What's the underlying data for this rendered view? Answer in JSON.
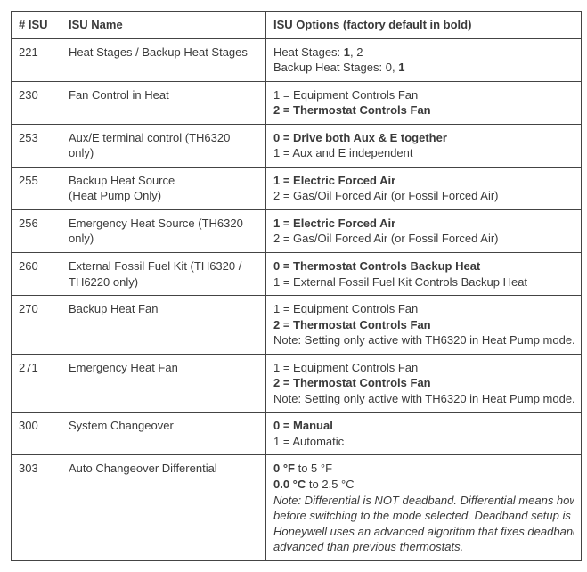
{
  "headers": {
    "isu": "# ISU",
    "name": "ISU Name",
    "options": "ISU Options (factory default in bold)"
  },
  "rows": [
    {
      "isu": "221",
      "name_lines": [
        {
          "text": "Heat Stages / Backup Heat Stages"
        }
      ],
      "option_lines": [
        {
          "segments": [
            {
              "t": "Heat Stages: "
            },
            {
              "t": "1",
              "b": true
            },
            {
              "t": ", 2"
            }
          ]
        },
        {
          "segments": [
            {
              "t": "Backup Heat Stages: 0, "
            },
            {
              "t": "1",
              "b": true
            }
          ]
        }
      ]
    },
    {
      "isu": "230",
      "name_lines": [
        {
          "text": "Fan Control in Heat"
        }
      ],
      "option_lines": [
        {
          "segments": [
            {
              "t": "1 = Equipment Controls Fan"
            }
          ]
        },
        {
          "segments": [
            {
              "t": "2 = Thermostat Controls Fan",
              "b": true
            }
          ]
        }
      ]
    },
    {
      "isu": "253",
      "name_lines": [
        {
          "text": "Aux/E terminal control (TH6320 only)"
        }
      ],
      "option_lines": [
        {
          "segments": [
            {
              "t": "0 = Drive both Aux & E together",
              "b": true
            }
          ]
        },
        {
          "segments": [
            {
              "t": "1 = Aux and E independent"
            }
          ]
        }
      ]
    },
    {
      "isu": "255",
      "name_lines": [
        {
          "text": "Backup Heat Source"
        },
        {
          "text": "(Heat Pump Only)"
        }
      ],
      "option_lines": [
        {
          "segments": [
            {
              "t": "1 = Electric Forced Air",
              "b": true
            }
          ]
        },
        {
          "segments": [
            {
              "t": "2 = Gas/Oil Forced Air (or Fossil Forced Air)"
            }
          ]
        }
      ]
    },
    {
      "isu": "256",
      "name_lines": [
        {
          "text": "Emergency Heat Source (TH6320 only)"
        }
      ],
      "option_lines": [
        {
          "segments": [
            {
              "t": "1 = Electric Forced Air",
              "b": true
            }
          ]
        },
        {
          "segments": [
            {
              "t": "2 = Gas/Oil Forced Air (or Fossil Forced Air)"
            }
          ]
        }
      ]
    },
    {
      "isu": "260",
      "name_lines": [
        {
          "text": "External Fossil Fuel Kit (TH6320 / TH6220 only)"
        }
      ],
      "option_lines": [
        {
          "segments": [
            {
              "t": "0 = Thermostat Controls Backup Heat",
              "b": true
            }
          ]
        },
        {
          "segments": [
            {
              "t": "1 = External Fossil Fuel Kit Controls Backup Heat"
            }
          ]
        }
      ]
    },
    {
      "isu": "270",
      "name_lines": [
        {
          "text": "Backup Heat Fan"
        }
      ],
      "option_lines": [
        {
          "segments": [
            {
              "t": "1 = Equipment Controls Fan"
            }
          ]
        },
        {
          "segments": [
            {
              "t": "2 = Thermostat Controls Fan",
              "b": true
            }
          ]
        },
        {
          "note": true,
          "segments": [
            {
              "t": "Note: Setting only active with TH6320 in Heat Pump mode."
            }
          ]
        }
      ]
    },
    {
      "isu": "271",
      "name_lines": [
        {
          "text": "Emergency Heat Fan"
        }
      ],
      "option_lines": [
        {
          "segments": [
            {
              "t": "1 = Equipment Controls Fan"
            }
          ]
        },
        {
          "segments": [
            {
              "t": "2 = Thermostat Controls Fan",
              "b": true
            }
          ]
        },
        {
          "note": true,
          "segments": [
            {
              "t": "Note: Setting only active with TH6320 in Heat Pump mode."
            }
          ]
        }
      ]
    },
    {
      "isu": "300",
      "name_lines": [
        {
          "text": "System Changeover"
        }
      ],
      "option_lines": [
        {
          "segments": [
            {
              "t": "0 = Manual",
              "b": true
            }
          ]
        },
        {
          "segments": [
            {
              "t": "1 = Automatic"
            }
          ]
        }
      ]
    },
    {
      "isu": "303",
      "name_lines": [
        {
          "text": "Auto Changeover Differential"
        }
      ],
      "option_lines": [
        {
          "segments": [
            {
              "t": "0 °F",
              "b": true
            },
            {
              "t": " to 5 °F"
            }
          ]
        },
        {
          "segments": [
            {
              "t": "0.0 °C",
              "b": true
            },
            {
              "t": " to 2.5 °C"
            }
          ]
        },
        {
          "note": true,
          "segments": [
            {
              "t": "Note: Differential is NOT deadband. Differential means how far",
              "i": true
            }
          ]
        },
        {
          "note": true,
          "segments": [
            {
              "t": "before switching to the mode selected. Deadband setup is not",
              "i": true
            }
          ]
        },
        {
          "note": true,
          "segments": [
            {
              "t": "Honeywell uses an advanced algorithm that fixes deadband at",
              "i": true
            }
          ]
        },
        {
          "note": true,
          "segments": [
            {
              "t": "advanced than previous thermostats.",
              "i": true
            }
          ]
        }
      ]
    }
  ]
}
